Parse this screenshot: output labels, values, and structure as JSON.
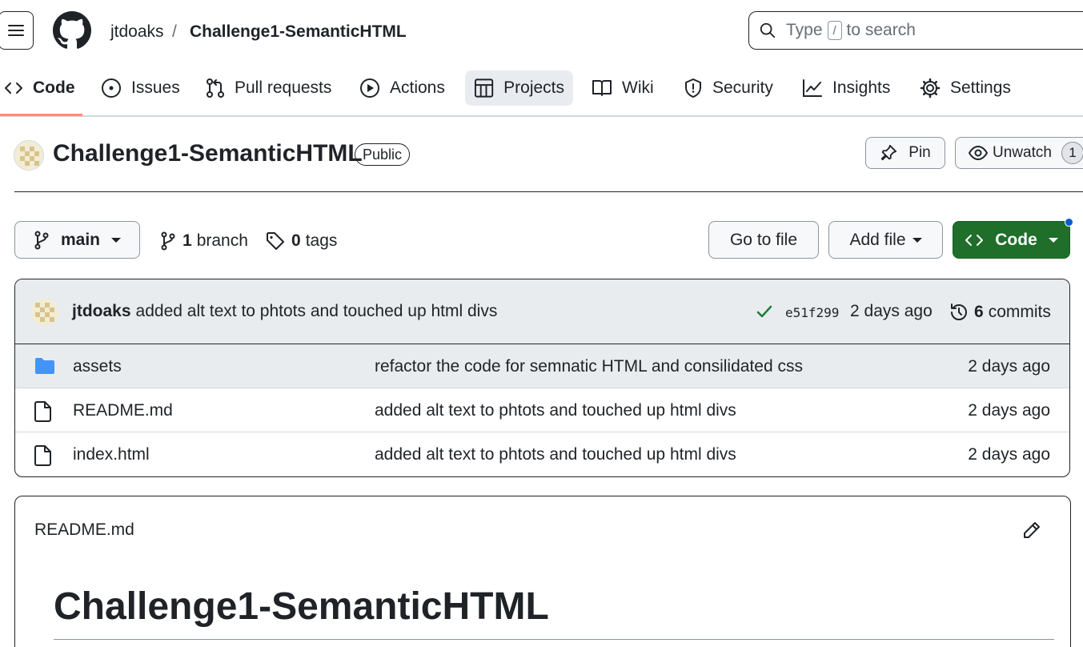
{
  "header": {
    "owner": "jtdoaks",
    "separator": "/",
    "repo": "Challenge1-SemanticHTML",
    "search_prefix": "Type",
    "search_key": "/",
    "search_suffix": "to search"
  },
  "tabs": [
    {
      "label": "Code",
      "icon": "code-icon",
      "active": true
    },
    {
      "label": "Issues",
      "icon": "issue-icon"
    },
    {
      "label": "Pull requests",
      "icon": "pull-request-icon"
    },
    {
      "label": "Actions",
      "icon": "play-icon"
    },
    {
      "label": "Projects",
      "icon": "table-icon",
      "highlighted": true
    },
    {
      "label": "Wiki",
      "icon": "book-icon"
    },
    {
      "label": "Security",
      "icon": "shield-icon"
    },
    {
      "label": "Insights",
      "icon": "graph-icon"
    },
    {
      "label": "Settings",
      "icon": "gear-icon"
    }
  ],
  "repo": {
    "title": "Challenge1-SemanticHTML",
    "visibility": "Public",
    "pin_label": "Pin",
    "unwatch_label": "Unwatch",
    "watch_count": "1"
  },
  "branch_bar": {
    "branch": "main",
    "branch_count": "1",
    "branch_label": "branch",
    "tag_count": "0",
    "tag_label": "tags",
    "go_to_file": "Go to file",
    "add_file": "Add file",
    "code": "Code"
  },
  "latest_commit": {
    "author": "jtdoaks",
    "message": "added alt text to phtots and touched up html divs",
    "sha": "e51f299",
    "time": "2 days ago",
    "commit_count": "6",
    "commit_label": "commits"
  },
  "files": [
    {
      "name": "assets",
      "type": "folder",
      "commit": "refactor the code for semnatic HTML and consilidated css",
      "time": "2 days ago"
    },
    {
      "name": "README.md",
      "type": "file",
      "commit": "added alt text to phtots and touched up html divs",
      "time": "2 days ago"
    },
    {
      "name": "index.html",
      "type": "file",
      "commit": "added alt text to phtots and touched up html divs",
      "time": "2 days ago"
    }
  ],
  "readme": {
    "filename": "README.md",
    "heading": "Challenge1-SemanticHTML"
  },
  "colors": {
    "accent_green": "#1f6e2a",
    "active_tab_underline": "#fd8c73",
    "folder_blue": "#4493f8",
    "check_green": "#1a7f37"
  }
}
